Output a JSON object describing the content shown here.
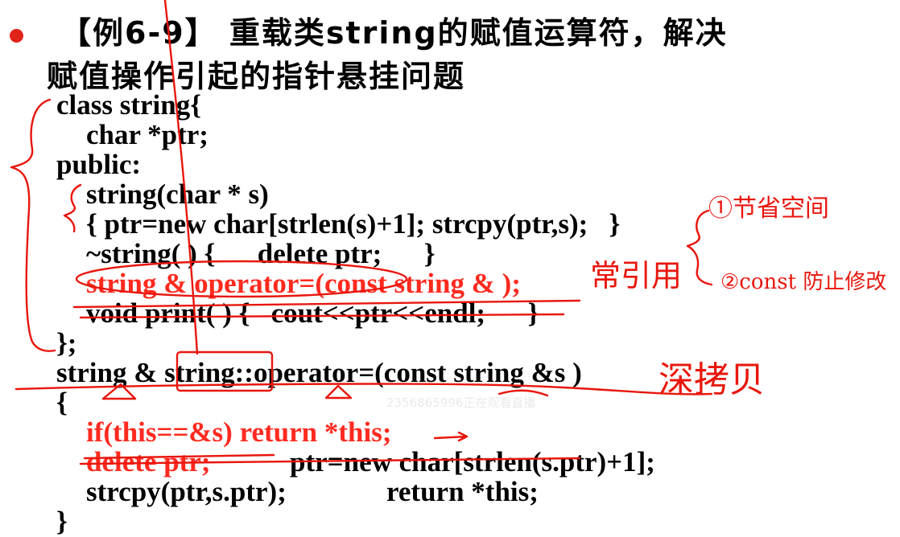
{
  "title": {
    "line1": "【例6-9】 重载类string的赋值运算符，解决",
    "line2": "赋值操作引起的指针悬挂问题"
  },
  "code": {
    "l1": "class string{",
    "l2": "char *ptr;",
    "l3": "public:",
    "l4": "string(char * s)",
    "l5": "{ ptr=new char[strlen(s)+1]; strcpy(ptr,s);   }",
    "l6": "~string( ) {      delete ptr;      }",
    "l7": "string & operator=(const string & );",
    "l8": "void print( ) {   cout<<ptr<<endl;      }",
    "l9": "};",
    "l10": "string & string::operator=(const string &s )",
    "l11": "{",
    "l12": "if(this==&s) return *this;",
    "l13a": "delete ptr;",
    "l13b": "ptr=new char[strlen(s.ptr)+1];",
    "l14a": "strcpy(ptr,s.ptr);",
    "l14b": "return *this;",
    "l15": "}"
  },
  "annotations": {
    "note1": "①节省空间",
    "note2": "②const 防止修改",
    "ref": "常引用",
    "deep": "深拷贝"
  },
  "watermark": "2356865996正在观看直播",
  "colors": {
    "accent": "#ff2a1f",
    "ink": "#e8160c",
    "text": "#000000"
  }
}
